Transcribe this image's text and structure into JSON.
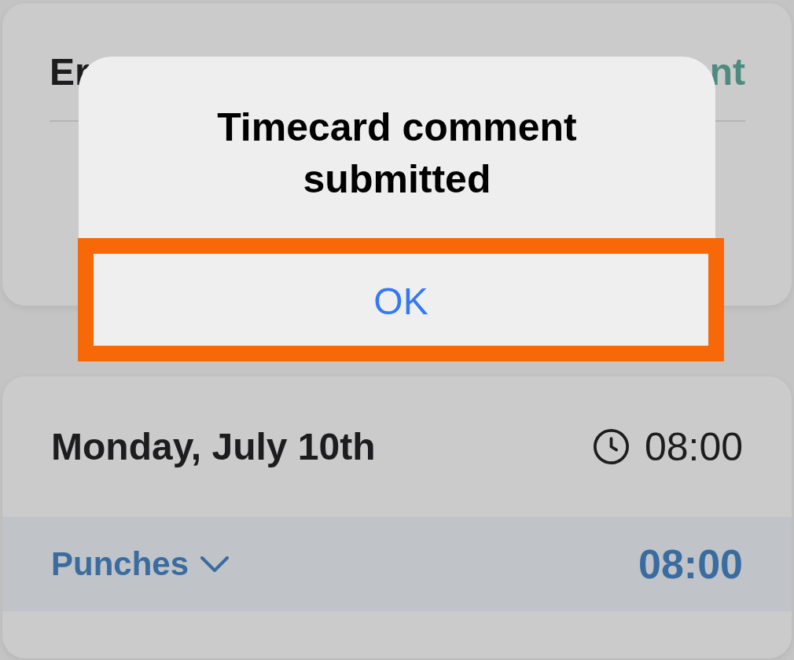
{
  "comment_card": {
    "title": "Er",
    "action": "nt"
  },
  "alert": {
    "title": "Timecard comment submitted",
    "buttons": [
      {
        "label": "OK",
        "highlighted": true
      }
    ]
  },
  "day_card": {
    "date": "Monday, July 10th",
    "total": "08:00",
    "punches": {
      "label": "Punches",
      "expanded": false,
      "total": "08:00"
    }
  }
}
